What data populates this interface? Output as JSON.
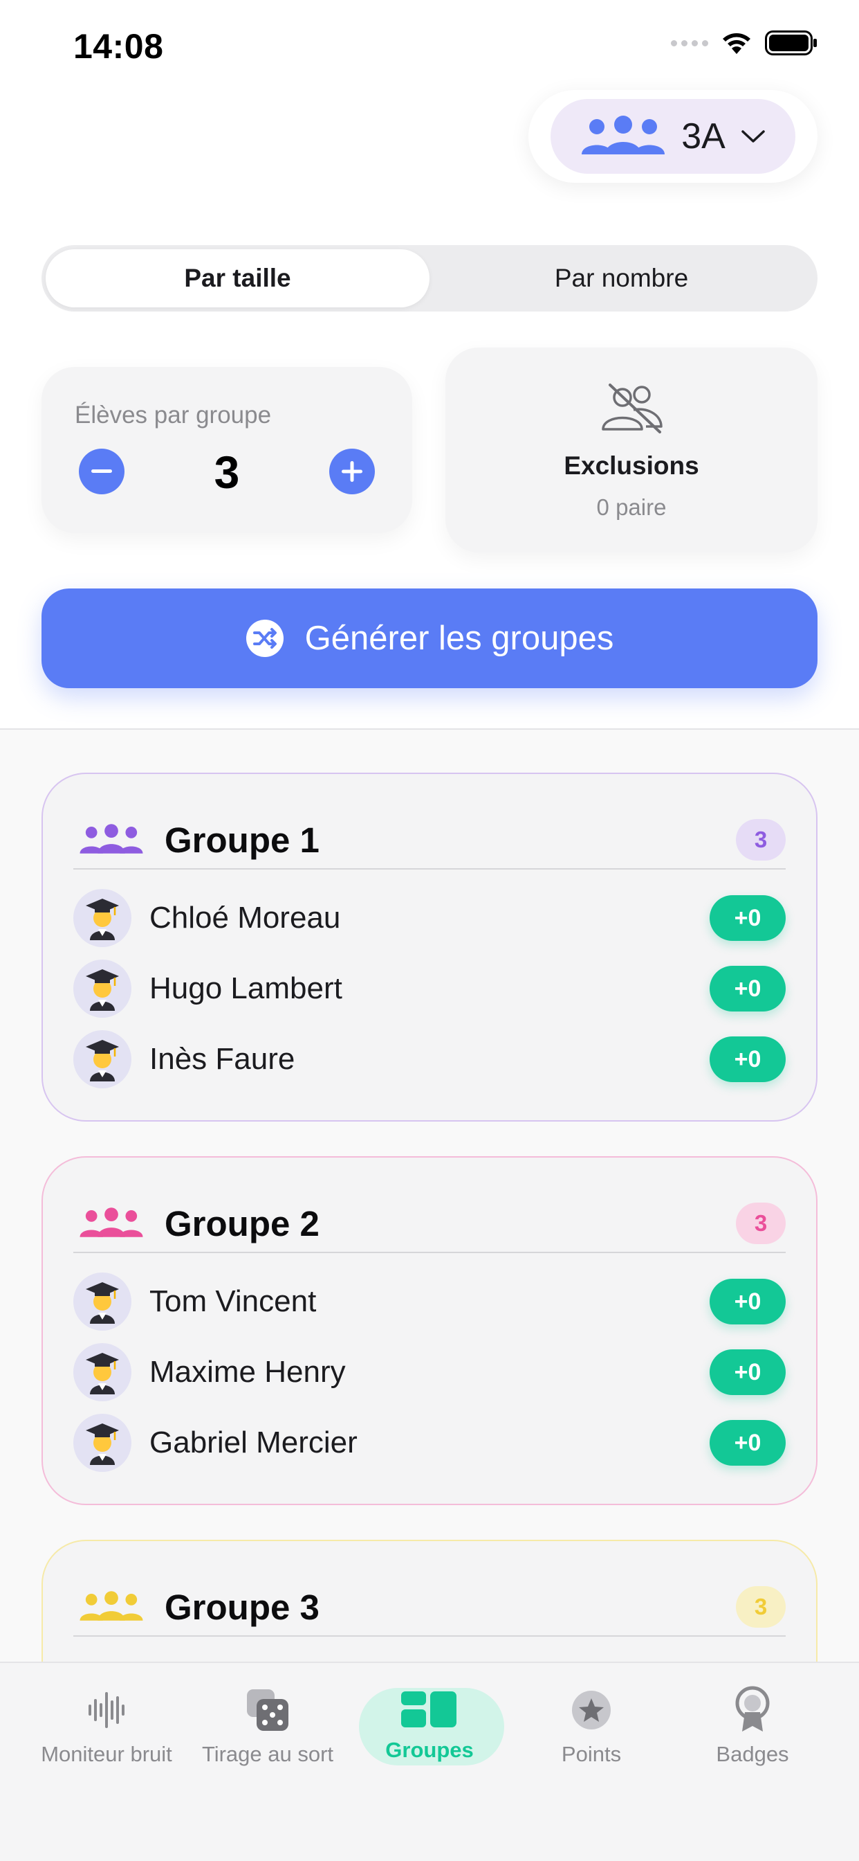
{
  "status_bar": {
    "time": "14:08"
  },
  "class_selector": {
    "label": "3A"
  },
  "mode_tabs": [
    {
      "label": "Par taille",
      "active": true
    },
    {
      "label": "Par nombre",
      "active": false
    }
  ],
  "per_group": {
    "label": "Élèves par groupe",
    "value": "3"
  },
  "exclusions": {
    "title": "Exclusions",
    "subtitle": "0 paire"
  },
  "generate_button": {
    "label": "Générer les groupes"
  },
  "groups": [
    {
      "title": "Groupe 1",
      "count": "3",
      "color": "#8e5ce0",
      "members": [
        {
          "name": "Chloé Moreau",
          "points": "+0"
        },
        {
          "name": "Hugo Lambert",
          "points": "+0"
        },
        {
          "name": "Inès Faure",
          "points": "+0"
        }
      ]
    },
    {
      "title": "Groupe 2",
      "count": "3",
      "color": "#ea4f9a",
      "members": [
        {
          "name": "Tom Vincent",
          "points": "+0"
        },
        {
          "name": "Maxime Henry",
          "points": "+0"
        },
        {
          "name": "Gabriel Mercier",
          "points": "+0"
        }
      ]
    },
    {
      "title": "Groupe 3",
      "count": "3",
      "color": "#f1cc37",
      "members": []
    }
  ],
  "tab_bar": [
    {
      "label": "Moniteur bruit",
      "icon": "waveform-icon"
    },
    {
      "label": "Tirage au sort",
      "icon": "dice-icon"
    },
    {
      "label": "Groupes",
      "icon": "grid-icon",
      "active": true
    },
    {
      "label": "Points",
      "icon": "star-icon"
    },
    {
      "label": "Badges",
      "icon": "award-icon"
    }
  ],
  "colors": {
    "accent": "#5a7cf5",
    "success": "#13c896"
  }
}
